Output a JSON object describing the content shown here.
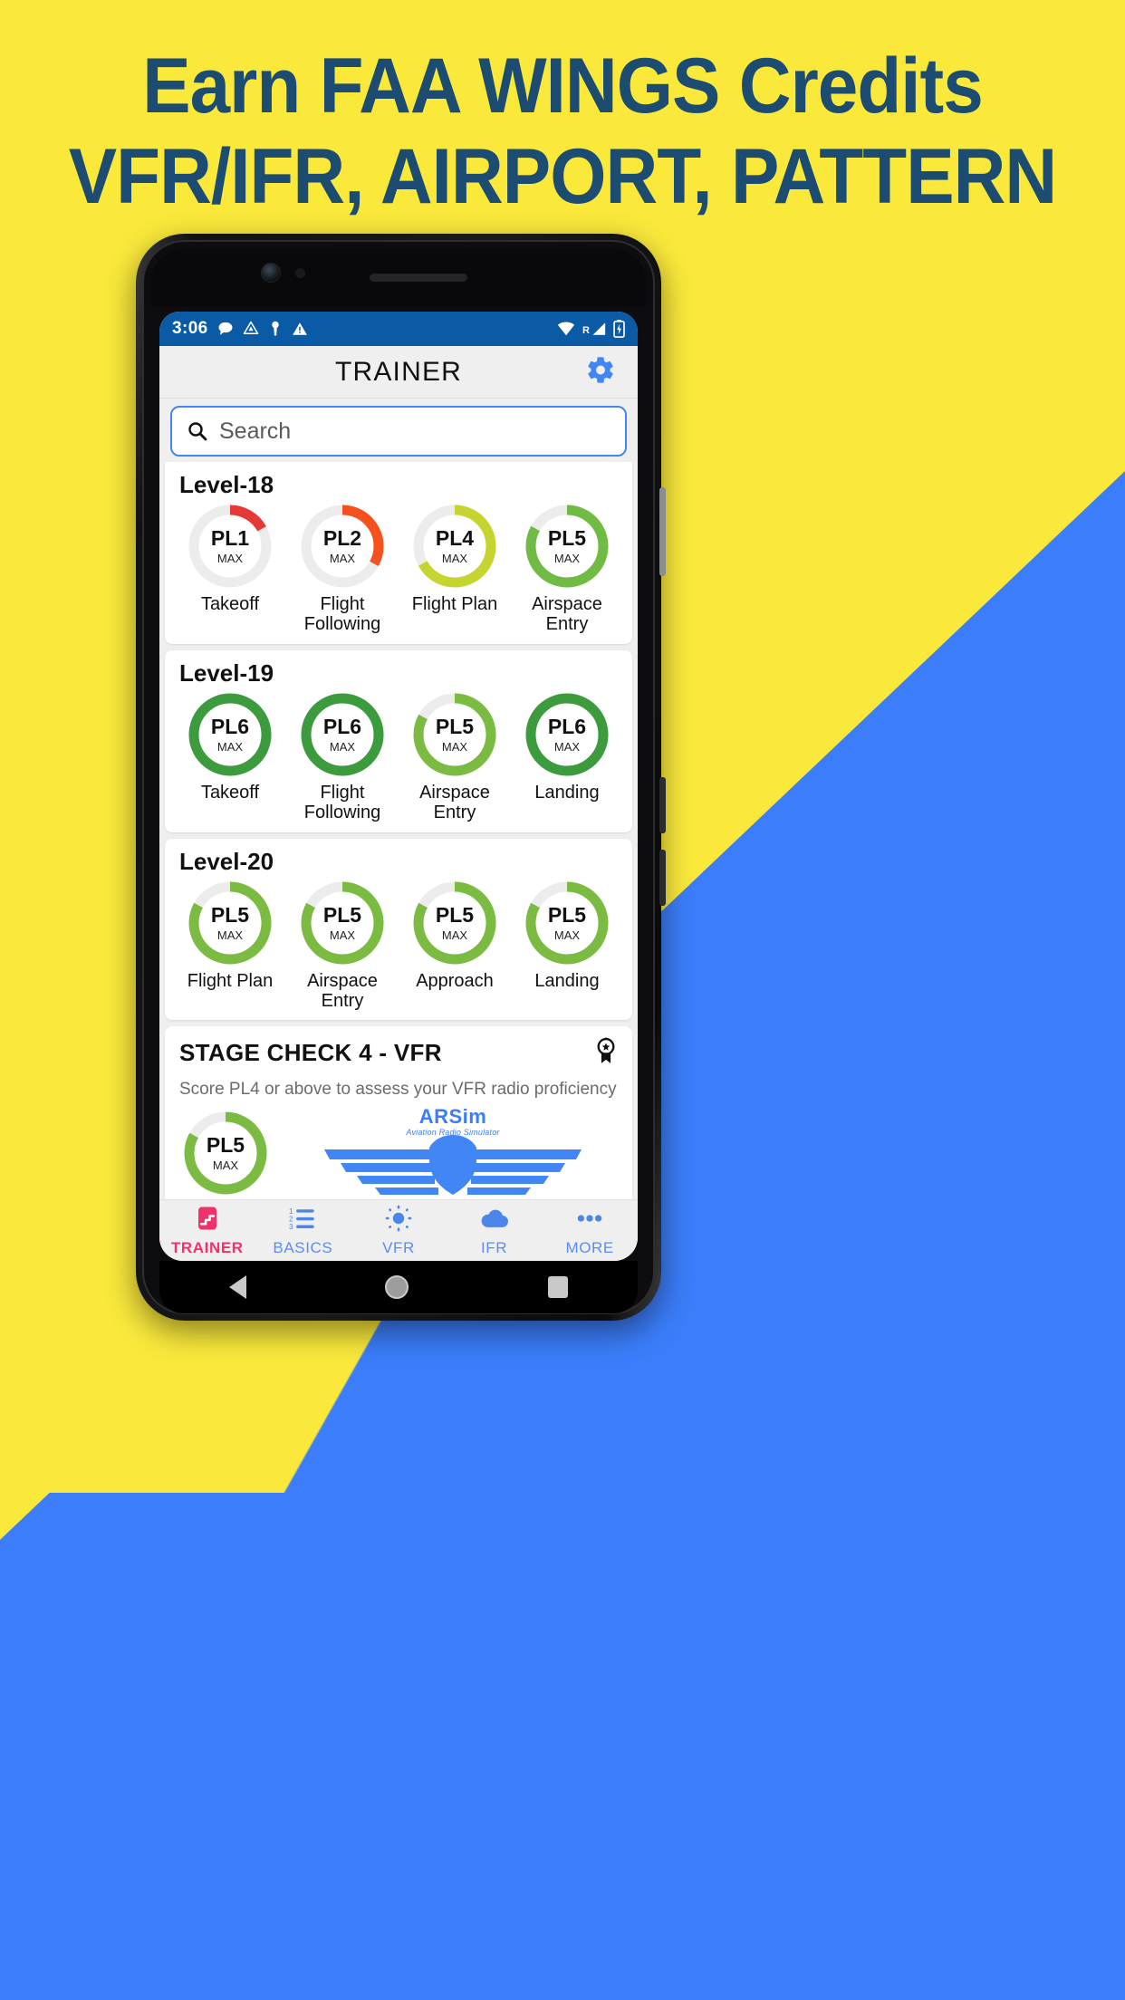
{
  "promo": {
    "headline_line1": "Earn FAA WINGS Credits",
    "headline_line2": "VFR/IFR, AIRPORT, PATTERN",
    "bg_yellow": "#FAE93B",
    "bg_blue": "#3B7DFA",
    "headline_color": "#1C4C72"
  },
  "status_bar": {
    "time": "3:06",
    "left_icons": [
      "message-icon",
      "drive-icon",
      "key-icon",
      "warning-icon"
    ],
    "right_icons": [
      "wifi-icon",
      "roaming-signal-icon",
      "battery-charging-icon"
    ],
    "roaming_label": "R",
    "background": "#0B5AA6"
  },
  "appbar": {
    "title": "TRAINER",
    "settings_icon": "gear-icon",
    "accent": "#4285F4"
  },
  "search": {
    "placeholder": "Search",
    "value": "",
    "icon": "search-icon"
  },
  "levels": [
    {
      "title": "Level-18",
      "items": [
        {
          "score": "PL1",
          "sub": "MAX",
          "caption": "Takeoff",
          "percent": 17,
          "color": "#E53935"
        },
        {
          "score": "PL2",
          "sub": "MAX",
          "caption": "Flight Following",
          "percent": 33,
          "color": "#F4511E"
        },
        {
          "score": "PL4",
          "sub": "MAX",
          "caption": "Flight Plan",
          "percent": 67,
          "color": "#C6D42F"
        },
        {
          "score": "PL5",
          "sub": "MAX",
          "caption": "Airspace Entry",
          "percent": 83,
          "color": "#6FBB44"
        }
      ]
    },
    {
      "title": "Level-19",
      "items": [
        {
          "score": "PL6",
          "sub": "MAX",
          "caption": "Takeoff",
          "percent": 100,
          "color": "#3C9B3C"
        },
        {
          "score": "PL6",
          "sub": "MAX",
          "caption": "Flight Following",
          "percent": 100,
          "color": "#3C9B3C"
        },
        {
          "score": "PL5",
          "sub": "MAX",
          "caption": "Airspace Entry",
          "percent": 83,
          "color": "#7CBB42"
        },
        {
          "score": "PL6",
          "sub": "MAX",
          "caption": "Landing",
          "percent": 100,
          "color": "#3C9B3C"
        }
      ]
    },
    {
      "title": "Level-20",
      "items": [
        {
          "score": "PL5",
          "sub": "MAX",
          "caption": "Flight Plan",
          "percent": 83,
          "color": "#7CBB42"
        },
        {
          "score": "PL5",
          "sub": "MAX",
          "caption": "Airspace Entry",
          "percent": 83,
          "color": "#7CBB42"
        },
        {
          "score": "PL5",
          "sub": "MAX",
          "caption": "Approach",
          "percent": 83,
          "color": "#7CBB42"
        },
        {
          "score": "PL5",
          "sub": "MAX",
          "caption": "Landing",
          "percent": 83,
          "color": "#7CBB42"
        }
      ]
    }
  ],
  "stage_check": {
    "title": "STAGE CHECK 4 - VFR",
    "badge_icon": "award-ribbon-icon",
    "subtitle": "Score PL4 or above to assess your VFR radio proficiency",
    "ring": {
      "score": "PL5",
      "sub": "MAX",
      "percent": 83,
      "color": "#7CBB42"
    },
    "logo": {
      "name": "ARSim",
      "tagline": "Aviation Radio Simulator",
      "color": "#3B7DFA"
    }
  },
  "bottom_nav": {
    "active_color": "#F0326A",
    "inactive_color": "#5B8DEF",
    "items": [
      {
        "label": "TRAINER",
        "icon": "stairs-icon",
        "active": true
      },
      {
        "label": "BASICS",
        "icon": "numbered-list-icon",
        "active": false
      },
      {
        "label": "VFR",
        "icon": "sun-icon",
        "active": false
      },
      {
        "label": "IFR",
        "icon": "cloud-icon",
        "active": false
      },
      {
        "label": "MORE",
        "icon": "ellipsis-icon",
        "active": false
      }
    ]
  },
  "android_nav": {
    "back": "back-triangle-icon",
    "home": "home-circle-icon",
    "recents": "recents-square-icon"
  }
}
